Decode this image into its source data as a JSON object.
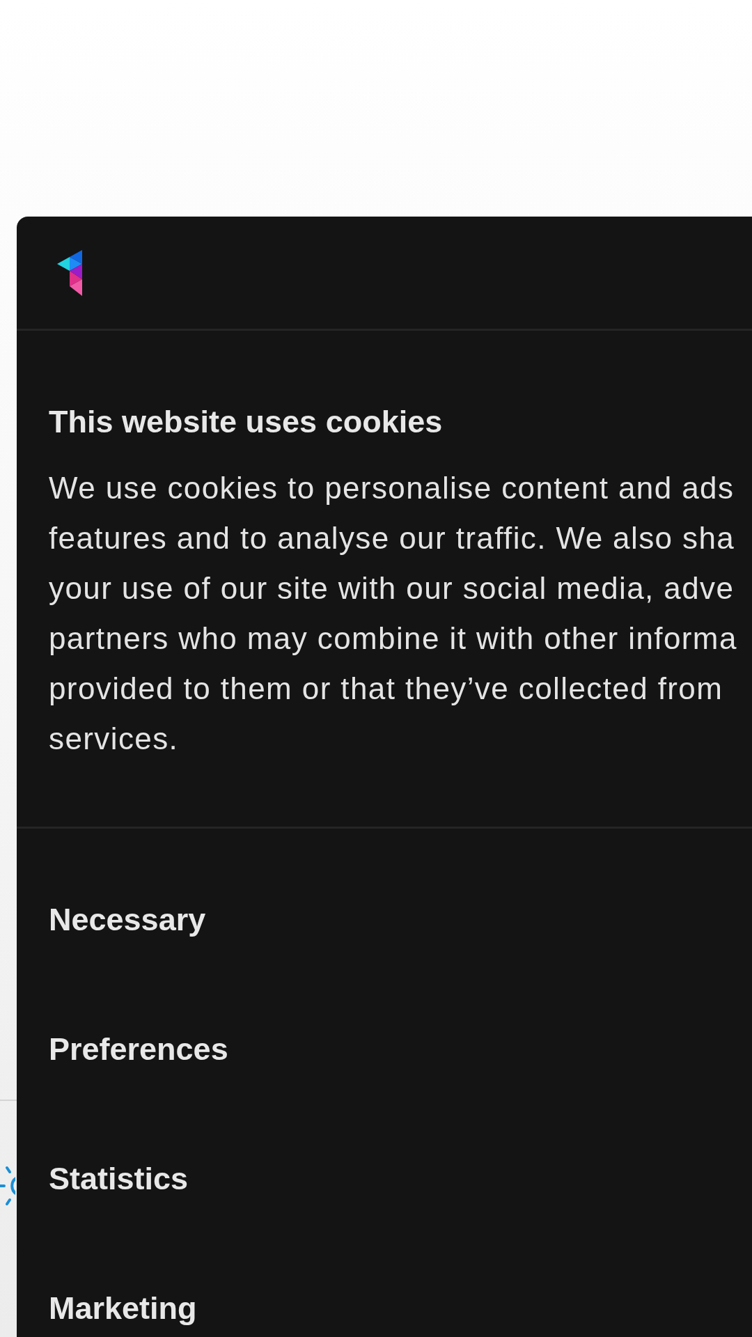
{
  "dialog": {
    "title": "This website uses cookies",
    "paragraph_lines": [
      "We use cookies to personalise content and ads",
      "features and to analyse our traffic. We also sha",
      "your use of our site with our social media, adve",
      "partners who may combine it with other informa",
      "provided to them or that they’ve collected from",
      "services."
    ],
    "categories": [
      {
        "label": "Necessary"
      },
      {
        "label": "Preferences"
      },
      {
        "label": "Statistics"
      },
      {
        "label": "Marketing"
      }
    ]
  }
}
